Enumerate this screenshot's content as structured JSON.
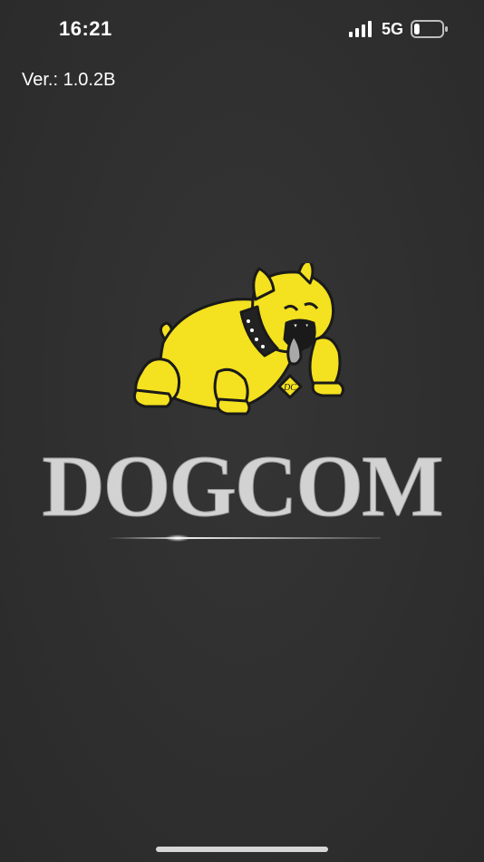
{
  "status_bar": {
    "time": "16:21",
    "network": "5G",
    "signal_icon": "signal-bars-icon",
    "battery_icon": "battery-icon",
    "battery_level": 0.2
  },
  "app": {
    "version": "Ver.: 1.0.2B",
    "logo_icon": "bulldog-logo-icon",
    "logo_text": "DOGCOM",
    "badge_text": "DC",
    "colors": {
      "background": "#2e2e2e",
      "dog_yellow": "#f4e11f",
      "wordmark": "#d2d2d2"
    }
  }
}
